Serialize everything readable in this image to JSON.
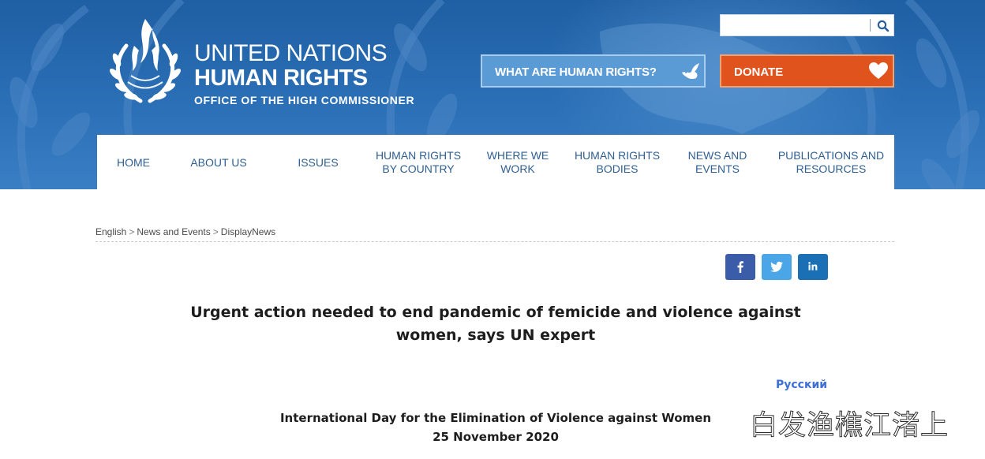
{
  "colors": {
    "banner_blue": "#2b6fb6",
    "nav_text": "#2f5f92",
    "donate_orange": "#e0531c",
    "what_button_blue": "#5b9bd5",
    "facebook": "#3b5ca8",
    "twitter": "#4aa6e6",
    "linkedin": "#1a6fb5",
    "language_link": "#3d6fd6"
  },
  "logo": {
    "line1": "UNITED NATIONS",
    "line2": "HUMAN RIGHTS",
    "line3": "OFFICE OF THE HIGH COMMISSIONER",
    "emblem_icon": "un-laurel-flame-icon"
  },
  "search": {
    "value": "",
    "placeholder": "",
    "icon": "search-icon"
  },
  "header_buttons": {
    "what_label": "WHAT ARE HUMAN RIGHTS?",
    "what_icon": "dove-icon",
    "donate_label": "DONATE",
    "donate_icon": "heart-icon"
  },
  "nav": {
    "items": [
      {
        "label": "HOME"
      },
      {
        "label": "ABOUT US"
      },
      {
        "label": "ISSUES"
      },
      {
        "label": "HUMAN RIGHTS\nBY COUNTRY"
      },
      {
        "label": "WHERE WE\nWORK"
      },
      {
        "label": "HUMAN RIGHTS\nBODIES"
      },
      {
        "label": "NEWS AND\nEVENTS"
      },
      {
        "label": "PUBLICATIONS AND\nRESOURCES"
      }
    ]
  },
  "breadcrumb": {
    "items": [
      "English",
      "News and Events",
      "DisplayNews"
    ],
    "separator": ">"
  },
  "share": {
    "facebook_icon": "facebook-icon",
    "twitter_icon": "twitter-icon",
    "linkedin_icon": "linkedin-icon"
  },
  "article": {
    "headline": "Urgent action needed to end pandemic of femicide and violence against women, says UN expert",
    "language_link": "Русский",
    "subhead_line1": "International Day for the Elimination of Violence against Women",
    "subhead_line2": "25 November 2020"
  },
  "watermark": "白发渔樵江渚上"
}
